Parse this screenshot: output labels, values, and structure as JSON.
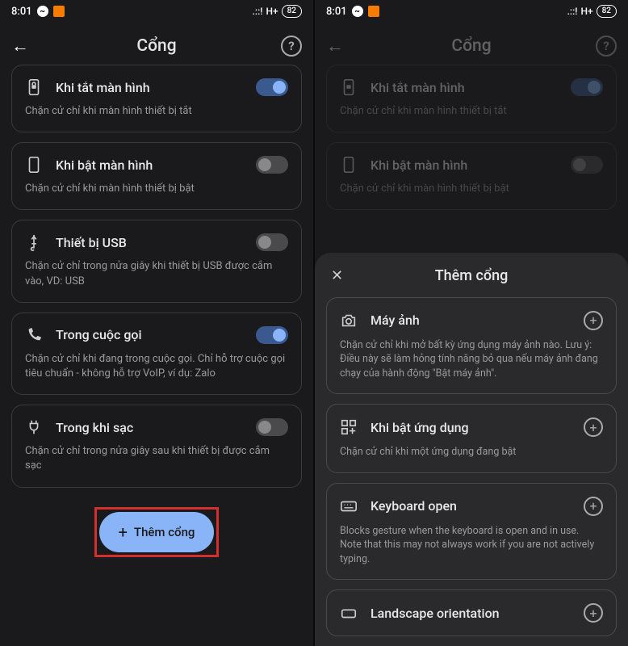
{
  "status": {
    "time": "8:01",
    "network": "H+",
    "battery": "82"
  },
  "left": {
    "title": "Cổng",
    "items": [
      {
        "title": "Khi tắt màn hình",
        "desc": "Chặn cử chỉ khi màn hình thiết bị tắt",
        "on": true
      },
      {
        "title": "Khi bật màn hình",
        "desc": "Chặn cử chỉ khi màn hình thiết bị bật",
        "on": false
      },
      {
        "title": "Thiết bị USB",
        "desc": "Chặn cử chỉ trong nửa giây khi thiết bị USB được cắm vào, VD: USB",
        "on": false
      },
      {
        "title": "Trong cuộc gọi",
        "desc": "Chặn cử chỉ khi đang trong cuộc gọi. Chỉ hỗ trợ cuộc gọi tiêu chuẩn - không hỗ trợ VoIP, ví dụ: Zalo",
        "on": true
      },
      {
        "title": "Trong khi sạc",
        "desc": "Chặn cử chỉ trong nửa giây sau khi thiết bị được cắm sạc",
        "on": false
      }
    ],
    "fab": "Thêm cổng"
  },
  "right": {
    "title": "Cổng",
    "items": [
      {
        "title": "Khi tắt màn hình",
        "desc": "Chặn cử chỉ khi màn hình thiết bị tắt",
        "on": true
      },
      {
        "title": "Khi bật màn hình",
        "desc": "Chặn cử chỉ khi màn hình thiết bị bật",
        "on": false
      }
    ],
    "sheet": {
      "title": "Thêm cổng",
      "items": [
        {
          "title": "Máy ảnh",
          "desc": "Chặn cử chỉ khi mở bất kỳ ứng dụng máy ảnh nào. Lưu ý: Điều này sẽ làm hỏng tính năng bỏ qua nếu máy ảnh đang chạy của hành động \"Bật máy ảnh\"."
        },
        {
          "title": "Khi bật ứng dụng",
          "desc": "Chặn cử chỉ khi một ứng dụng đang bật"
        },
        {
          "title": "Keyboard open",
          "desc": "Blocks gesture when the keyboard is open and in use. Note that this may not always work if you are not actively typing."
        },
        {
          "title": "Landscape orientation",
          "desc": ""
        }
      ]
    }
  }
}
